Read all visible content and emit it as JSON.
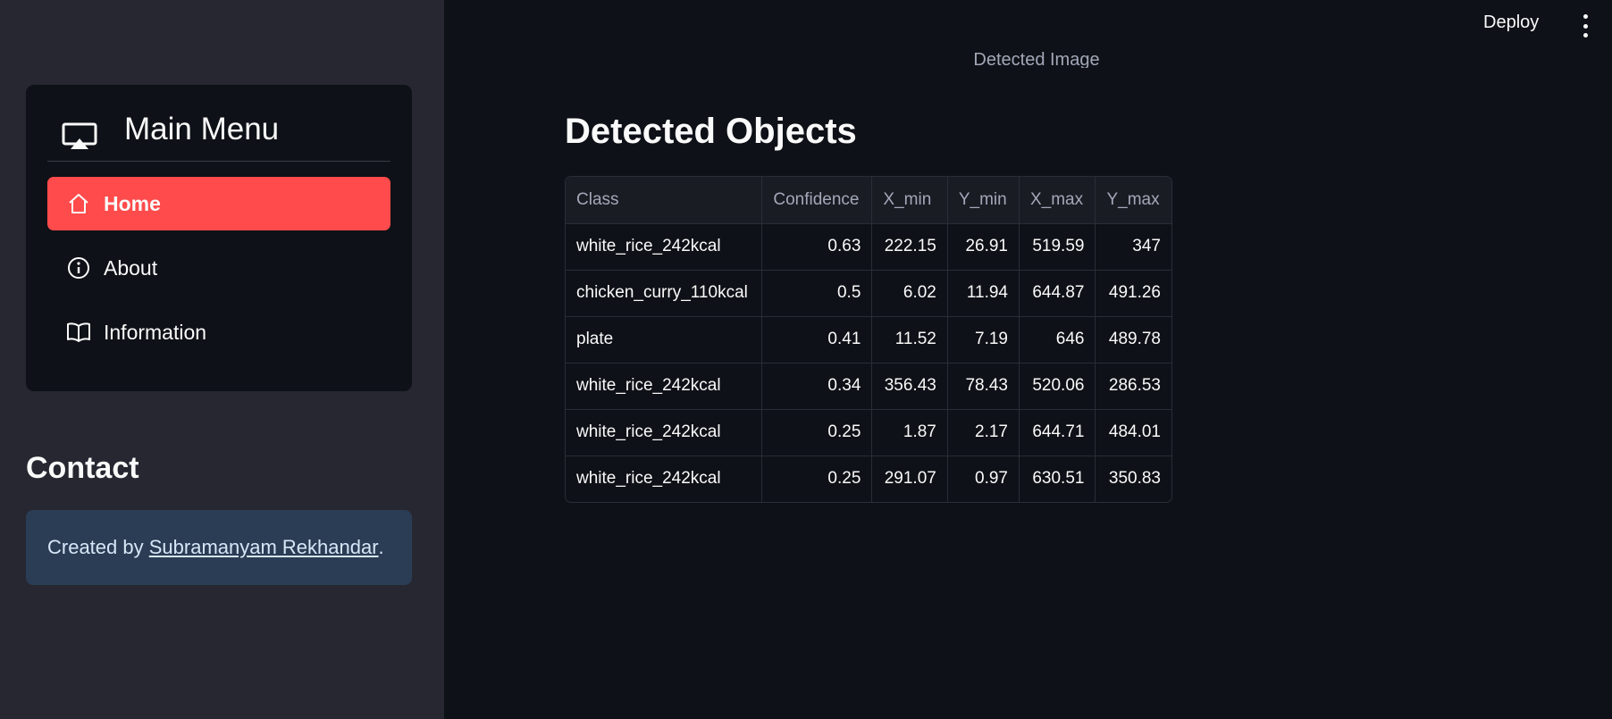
{
  "sidebar": {
    "menu_title": "Main Menu",
    "menu_icon": "cast-icon",
    "items": [
      {
        "label": "Home",
        "icon": "home-icon",
        "active": true
      },
      {
        "label": "About",
        "icon": "info-icon",
        "active": false
      },
      {
        "label": "Information",
        "icon": "book-icon",
        "active": false
      }
    ],
    "active_color": "#ff4b4b",
    "contact_title": "Contact",
    "contact_prefix": "Created by ",
    "contact_link": "Subramanyam Rekhandar",
    "contact_suffix": "."
  },
  "header": {
    "deploy_label": "Deploy",
    "menu_icon": "kebab-menu-icon"
  },
  "main": {
    "image_caption": "Detected Image",
    "section_title": "Detected Objects",
    "table": {
      "columns": [
        "Class",
        "Confidence",
        "X_min",
        "Y_min",
        "X_max",
        "Y_max"
      ],
      "rows": [
        [
          "white_rice_242kcal",
          "0.63",
          "222.15",
          "26.91",
          "519.59",
          "347"
        ],
        [
          "chicken_curry_110kcal",
          "0.5",
          "6.02",
          "11.94",
          "644.87",
          "491.26"
        ],
        [
          "plate",
          "0.41",
          "11.52",
          "7.19",
          "646",
          "489.78"
        ],
        [
          "white_rice_242kcal",
          "0.34",
          "356.43",
          "78.43",
          "520.06",
          "286.53"
        ],
        [
          "white_rice_242kcal",
          "0.25",
          "1.87",
          "2.17",
          "644.71",
          "484.01"
        ],
        [
          "white_rice_242kcal",
          "0.25",
          "291.07",
          "0.97",
          "630.51",
          "350.83"
        ]
      ]
    }
  }
}
